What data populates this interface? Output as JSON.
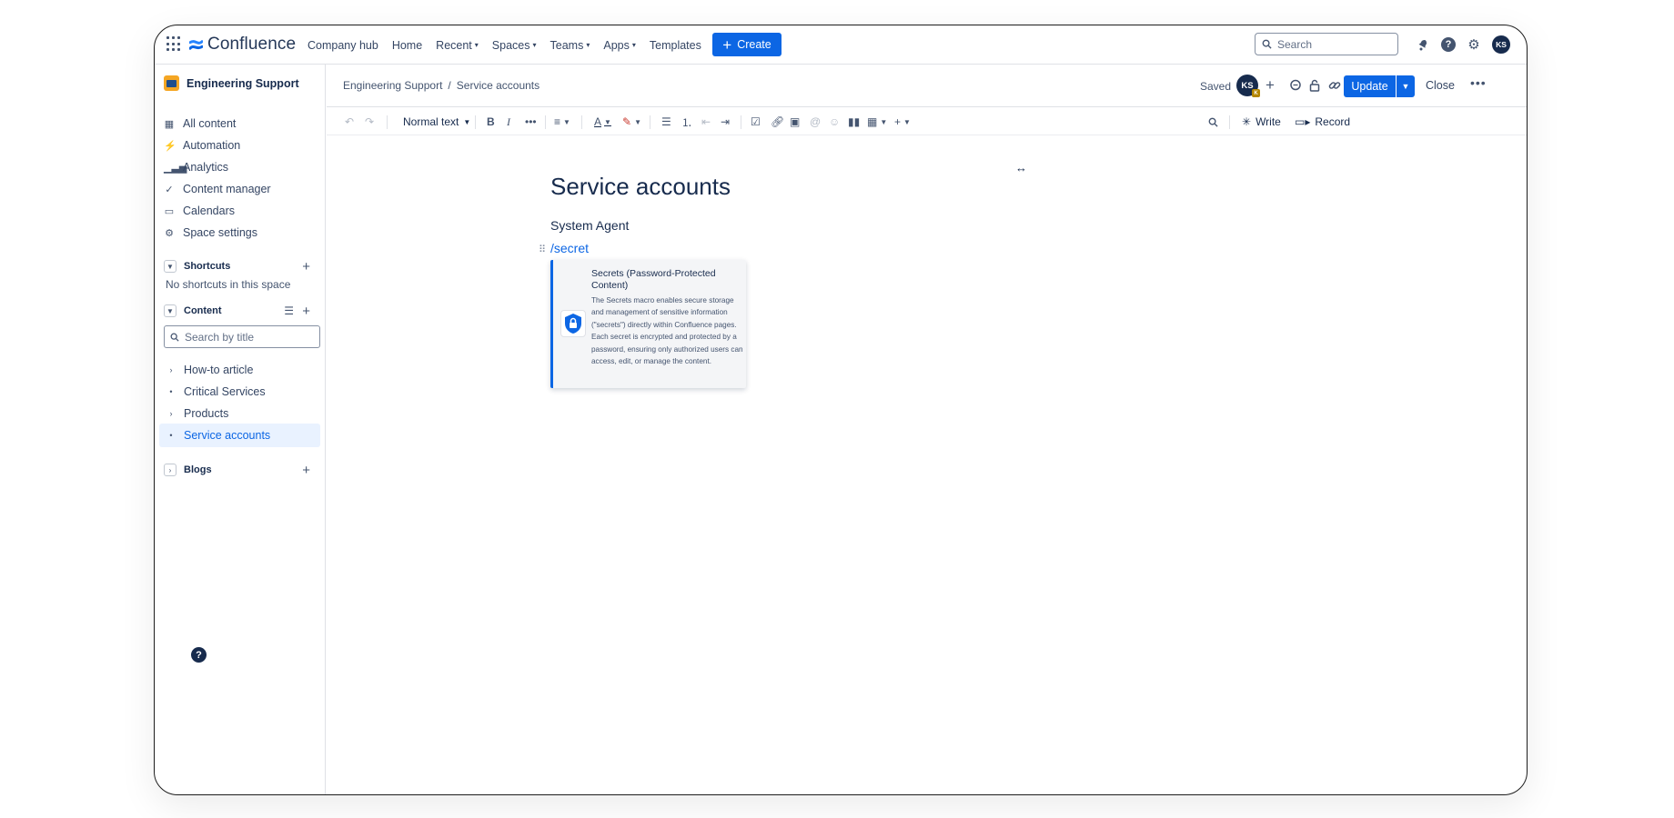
{
  "app": {
    "name": "Confluence",
    "nav": [
      "Company hub",
      "Home",
      "Recent",
      "Spaces",
      "Teams",
      "Apps",
      "Templates"
    ],
    "nav_dropdown": [
      false,
      false,
      true,
      true,
      true,
      true,
      false
    ],
    "create_label": "Create",
    "search_placeholder": "Search",
    "user_initials": "KS",
    "brand_color": "#0c66e4"
  },
  "sidebar": {
    "space_name": "Engineering Support",
    "items": [
      {
        "label": "All content",
        "icon": "grid-icon"
      },
      {
        "label": "Automation",
        "icon": "lightning-icon"
      },
      {
        "label": "Analytics",
        "icon": "bar-chart-icon"
      },
      {
        "label": "Content manager",
        "icon": "content-manager-icon"
      },
      {
        "label": "Calendars",
        "icon": "calendar-icon"
      },
      {
        "label": "Space settings",
        "icon": "gear-icon"
      }
    ],
    "shortcuts": {
      "label": "Shortcuts",
      "empty_text": "No shortcuts in this space"
    },
    "content": {
      "label": "Content",
      "search_placeholder": "Search by title",
      "tree": [
        {
          "label": "How-to article",
          "expandable": true
        },
        {
          "label": "Critical Services",
          "expandable": false
        },
        {
          "label": "Products",
          "expandable": true
        },
        {
          "label": "Service accounts",
          "expandable": false,
          "active": true
        }
      ]
    },
    "blogs": {
      "label": "Blogs"
    }
  },
  "pagebar": {
    "breadcrumb": [
      "Engineering Support",
      "Service accounts"
    ],
    "breadcrumb_sep": "/",
    "status": "Saved",
    "collaborator_initials": "KS",
    "collaborator_badge": "K",
    "update_label": "Update",
    "close_label": "Close"
  },
  "toolbar": {
    "text_style": "Normal text",
    "write_label": "Write",
    "record_label": "Record"
  },
  "editor": {
    "title": "Service accounts",
    "paragraph": "System Agent",
    "slash_command": "/secret",
    "suggestion": {
      "title": "Secrets (Password-Protected Content)",
      "description": "The Secrets macro enables secure storage and management of sensitive information (\"secrets\") directly within Confluence pages. Each secret is encrypted and protected by a password, ensuring only authorized users can access, edit, or manage the content."
    }
  }
}
